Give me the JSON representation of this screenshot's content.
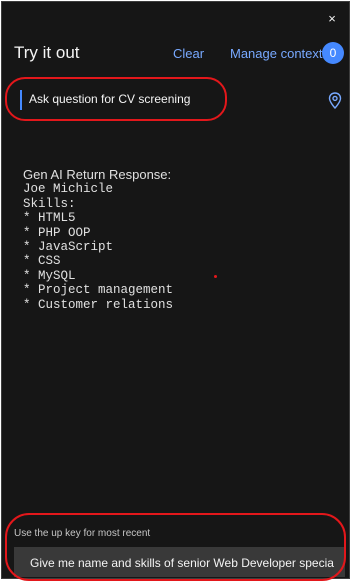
{
  "panel": {
    "close_symbol": "×",
    "title": "Try it out",
    "clear_label": "Clear",
    "manage_context_label": "Manage context",
    "context_count": "0"
  },
  "prompt": {
    "label": "Ask question for CV screening",
    "pin_icon": "location-pin-icon"
  },
  "response": {
    "heading": "Gen AI Return Response:",
    "lines": [
      "Joe Michicle",
      "Skills:",
      "",
      "* HTML5",
      "* PHP OOP",
      "* JavaScript",
      "* CSS",
      "* MySQL",
      "* Project management",
      "* Customer relations"
    ]
  },
  "footer": {
    "hint": "Use the up key for most recent",
    "input_value": "Give me name and skills of senior Web Developer specia"
  },
  "colors": {
    "background": "#161616",
    "link": "#78a9ff",
    "badge": "#4589ff",
    "annotation": "#e3171b"
  }
}
